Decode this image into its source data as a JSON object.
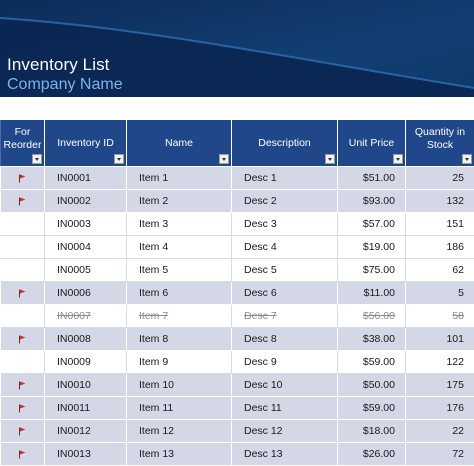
{
  "header": {
    "title": "Inventory List",
    "subtitle": "Company Name"
  },
  "colors": {
    "banner": "#0f3566",
    "header_row": "#1f4789",
    "flagged_row": "#d4d8e6",
    "flag": "#c0332b"
  },
  "table": {
    "columns": [
      {
        "label": "For Reorder"
      },
      {
        "label": "Inventory ID"
      },
      {
        "label": "Name"
      },
      {
        "label": "Description"
      },
      {
        "label": "Unit Price"
      },
      {
        "label": "Quantity in Stock"
      }
    ],
    "rows": [
      {
        "reorder": true,
        "discontinued": false,
        "id": "IN0001",
        "name": "Item 1",
        "description": "Desc 1",
        "unit_price": "$51.00",
        "quantity": "25"
      },
      {
        "reorder": true,
        "discontinued": false,
        "id": "IN0002",
        "name": "Item 2",
        "description": "Desc 2",
        "unit_price": "$93.00",
        "quantity": "132"
      },
      {
        "reorder": false,
        "discontinued": false,
        "id": "IN0003",
        "name": "Item 3",
        "description": "Desc 3",
        "unit_price": "$57.00",
        "quantity": "151"
      },
      {
        "reorder": false,
        "discontinued": false,
        "id": "IN0004",
        "name": "Item 4",
        "description": "Desc 4",
        "unit_price": "$19.00",
        "quantity": "186"
      },
      {
        "reorder": false,
        "discontinued": false,
        "id": "IN0005",
        "name": "Item 5",
        "description": "Desc 5",
        "unit_price": "$75.00",
        "quantity": "62"
      },
      {
        "reorder": true,
        "discontinued": false,
        "id": "IN0006",
        "name": "Item 6",
        "description": "Desc 6",
        "unit_price": "$11.00",
        "quantity": "5"
      },
      {
        "reorder": false,
        "discontinued": true,
        "id": "IN0007",
        "name": "Item 7",
        "description": "Desc 7",
        "unit_price": "$56.00",
        "quantity": "58"
      },
      {
        "reorder": true,
        "discontinued": false,
        "id": "IN0008",
        "name": "Item 8",
        "description": "Desc 8",
        "unit_price": "$38.00",
        "quantity": "101"
      },
      {
        "reorder": false,
        "discontinued": false,
        "id": "IN0009",
        "name": "Item 9",
        "description": "Desc 9",
        "unit_price": "$59.00",
        "quantity": "122"
      },
      {
        "reorder": true,
        "discontinued": false,
        "id": "IN0010",
        "name": "Item 10",
        "description": "Desc 10",
        "unit_price": "$50.00",
        "quantity": "175"
      },
      {
        "reorder": true,
        "discontinued": false,
        "id": "IN0011",
        "name": "Item 11",
        "description": "Desc 11",
        "unit_price": "$59.00",
        "quantity": "176"
      },
      {
        "reorder": true,
        "discontinued": false,
        "id": "IN0012",
        "name": "Item 12",
        "description": "Desc 12",
        "unit_price": "$18.00",
        "quantity": "22"
      },
      {
        "reorder": true,
        "discontinued": false,
        "id": "IN0013",
        "name": "Item 13",
        "description": "Desc 13",
        "unit_price": "$26.00",
        "quantity": "72"
      }
    ]
  }
}
